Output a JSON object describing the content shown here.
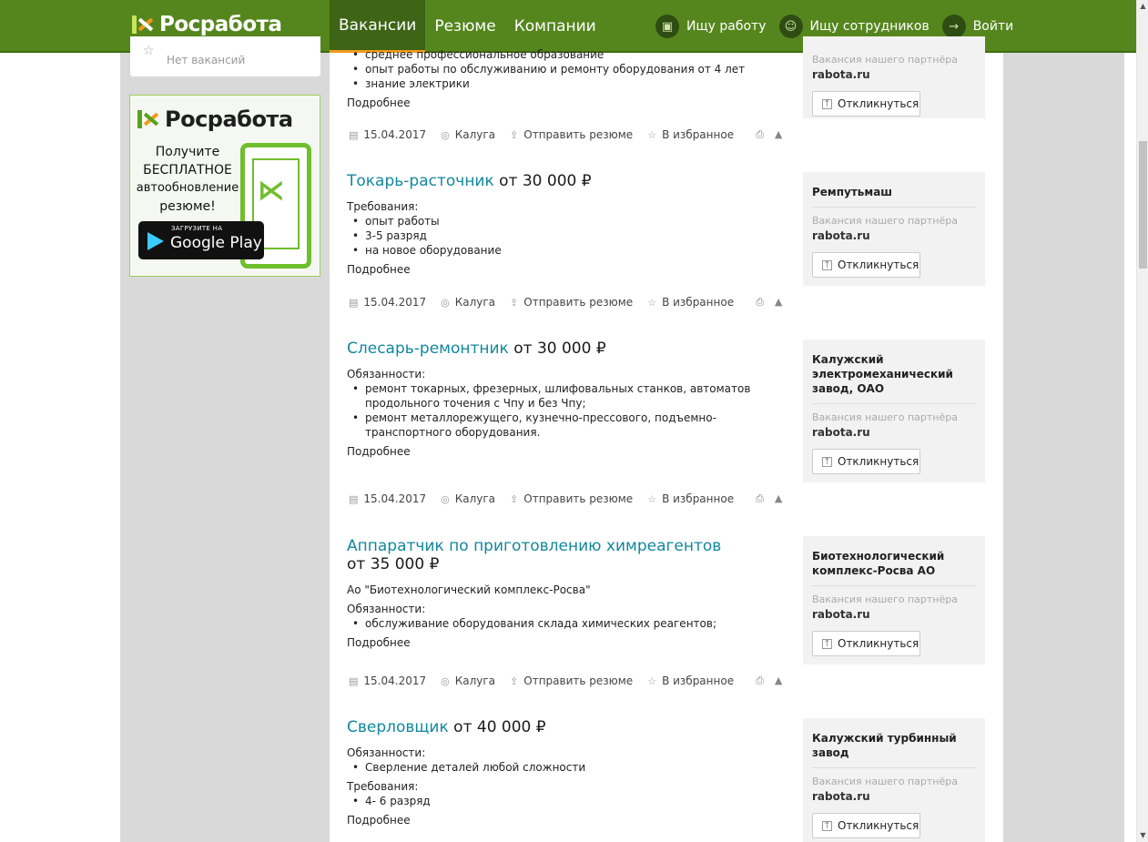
{
  "header": {
    "logo": "Росработа",
    "nav": [
      "Вакансии",
      "Резюме",
      "Компании"
    ],
    "right": [
      {
        "label": "Ищу работу",
        "icon": "briefcase-icon"
      },
      {
        "label": "Ищу сотрудников",
        "icon": "people-icon"
      },
      {
        "label": "Войти",
        "icon": "arrow-right-icon"
      }
    ]
  },
  "sidebar": {
    "saved_empty": "Нет вакансий",
    "ad": {
      "logo": "Росработа",
      "line1": "Получите",
      "line2": "БЕСПЛАТНОЕ",
      "line3": "автообновление",
      "line4": "резюме!",
      "store_small": "ЗАГРУЗИТЕ НА",
      "store_big": "Google Play"
    }
  },
  "vacancies": [
    {
      "title": "",
      "salary": "",
      "lines": [
        "среднее профессиональное образование",
        "опыт работы по обслуживанию и ремонту оборудования от 4 лет",
        "знание электрики"
      ],
      "more": "Подробнее",
      "date": "15.04.2017",
      "city": "Калуга",
      "send": "Отправить резюме",
      "fav": "В избранное",
      "company": "",
      "partner": "Вакансия нашего партнёра",
      "site": "rabota.ru",
      "respond": "Откликнуться"
    },
    {
      "title": "Токарь-расточник",
      "salary": "от 30 000 ₽",
      "section1": "Требования:",
      "lines": [
        "опыт работы",
        "3-5 разряд",
        "на новое оборудование"
      ],
      "more": "Подробнее",
      "date": "15.04.2017",
      "city": "Калуга",
      "send": "Отправить резюме",
      "fav": "В избранное",
      "company": "Ремпутьмаш",
      "partner": "Вакансия нашего партнёра",
      "site": "rabota.ru",
      "respond": "Откликнуться"
    },
    {
      "title": "Слесарь-ремонтник",
      "salary": "от 30 000 ₽",
      "section1": "Обязанности:",
      "lines": [
        "ремонт токарных, фрезерных, шлифовальных станков, автоматов продольного точения с Чпу и без Чпу;",
        "ремонт металлорежущего, кузнечно-прессового, подъемно-транспортного оборудования."
      ],
      "more": "Подробнее",
      "date": "15.04.2017",
      "city": "Калуга",
      "send": "Отправить резюме",
      "fav": "В избранное",
      "company": "Калужский электромеханический завод, ОАО",
      "partner": "Вакансия нашего партнёра",
      "site": "rabota.ru",
      "respond": "Откликнуться"
    },
    {
      "title": "Аппаратчик по приготовлению химреагентов",
      "salary": "от 35 000 ₽",
      "employer": "Ао \"Биотехнологический комплекс-Росва\"",
      "section1": "Обязанности:",
      "lines": [
        "обслуживание оборудования склада химических реагентов;"
      ],
      "more": "Подробнее",
      "date": "15.04.2017",
      "city": "Калуга",
      "send": "Отправить резюме",
      "fav": "В избранное",
      "company": "Биотехнологический комплекс-Росва АО",
      "partner": "Вакансия нашего партнёра",
      "site": "rabota.ru",
      "respond": "Откликнуться"
    },
    {
      "title": "Сверловщик",
      "salary": "от 40 000 ₽",
      "section1": "Обязанности:",
      "lines": [
        "Сверление деталей любой сложности"
      ],
      "section2": "Требования:",
      "lines2": [
        "4- 6 разряд"
      ],
      "more": "Подробнее",
      "company": "Калужский турбинный завод",
      "partner": "Вакансия нашего партнёра",
      "site": "rabota.ru",
      "respond": "Откликнуться"
    }
  ]
}
